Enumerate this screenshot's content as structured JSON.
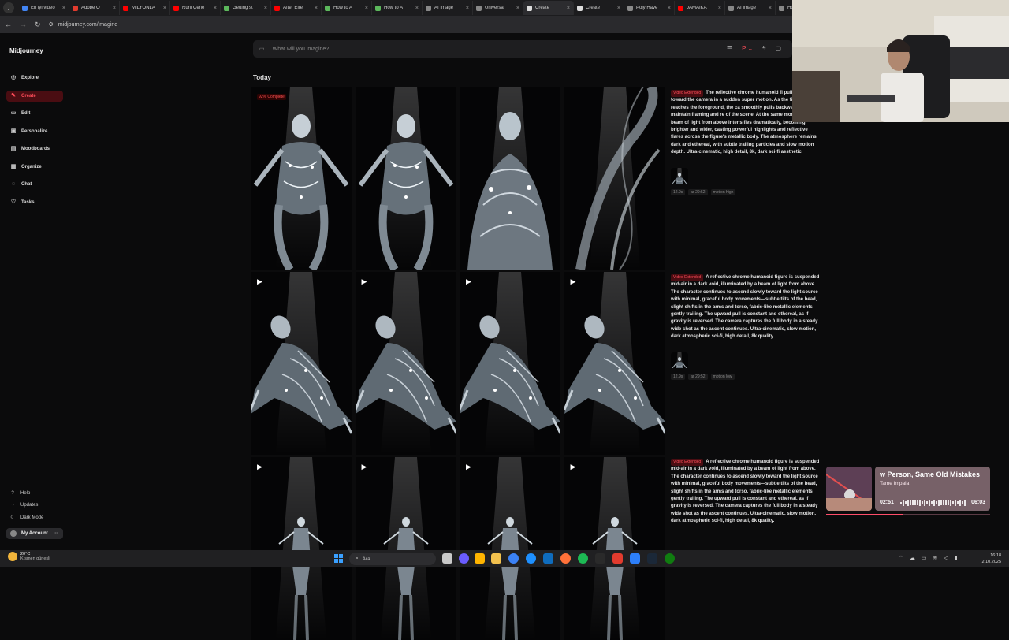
{
  "browser": {
    "tabs": [
      {
        "title": "En iyi video",
        "color": "#4285f4"
      },
      {
        "title": "Adobe Ö",
        "color": "#e23b2e"
      },
      {
        "title": "MİLYONLA",
        "color": "#ff0000"
      },
      {
        "title": "Ruhi Çene",
        "color": "#ff0000"
      },
      {
        "title": "Getting st",
        "color": "#5cb85c"
      },
      {
        "title": "After Effe",
        "color": "#ff0000"
      },
      {
        "title": "How to A",
        "color": "#5cb85c"
      },
      {
        "title": "How to A",
        "color": "#5cb85c"
      },
      {
        "title": "AI Image",
        "color": "#888888"
      },
      {
        "title": "Universal",
        "color": "#888888"
      },
      {
        "title": "Create",
        "color": "#dddddd",
        "active": true
      },
      {
        "title": "Create",
        "color": "#dddddd"
      },
      {
        "title": "Poly Have",
        "color": "#8a8a8a"
      },
      {
        "title": "JAMAİKA",
        "color": "#ff0000"
      },
      {
        "title": "AI Image",
        "color": "#888888"
      },
      {
        "title": "Ho",
        "color": "#888888"
      }
    ],
    "close_glyph": "×",
    "url": "midjourney.com/imagine"
  },
  "sidebar": {
    "brand": "Midjourney",
    "items": [
      {
        "label": "Explore",
        "icon": "compass-icon",
        "glyph": "◎"
      },
      {
        "label": "Create",
        "icon": "paintbrush-icon",
        "glyph": "✎",
        "active": true
      },
      {
        "label": "Edit",
        "icon": "edit-icon",
        "glyph": "▭"
      },
      {
        "label": "Personalize",
        "icon": "personalize-icon",
        "glyph": "▣"
      },
      {
        "label": "Moodboards",
        "icon": "moodboards-icon",
        "glyph": "▤"
      },
      {
        "label": "Organize",
        "icon": "organize-icon",
        "glyph": "▦"
      },
      {
        "label": "Chat",
        "icon": "chat-icon",
        "glyph": "◌"
      },
      {
        "label": "Tasks",
        "icon": "thumbs-up-icon",
        "glyph": "♡"
      }
    ],
    "bottom": [
      {
        "label": "Help",
        "glyph": "?"
      },
      {
        "label": "Updates",
        "glyph": "◔"
      },
      {
        "label": "Dark Mode",
        "glyph": "☾"
      }
    ],
    "account": "My Account"
  },
  "prompt_bar": {
    "placeholder": "What will you imagine?"
  },
  "feed": {
    "section": "Today",
    "groups": [
      {
        "badge": "Video Extended",
        "progress": "92% Complete",
        "text": "The reflective chrome humanoid fi pulled rapidly toward the camera in a sudden super motion. As the figure reaches the foreground, the ca smoothly pulls backward to maintain framing and re of the scene. At the same moment, the beam of light from above intensifies dramatically, becoming brighter and wider, casting powerful highlights and reflective flares across the figure's metallic body. The atmosphere remains dark and ethereal, with subtle trailing particles and slow motion depth. Ultra-cinematic, high detail, 8k, dark sci-fi aesthetic.",
        "meta": [
          "12.9s",
          "ar 29:52",
          "motion high"
        ]
      },
      {
        "badge": "Video Extended",
        "text": "A reflective chrome humanoid figure is suspended mid-air in a dark void, illuminated by a beam of light from above. The character continues to ascend slowly toward the light source with minimal, graceful body movements—subtle tilts of the head, slight shifts in the arms and torso, fabric-like metallic elements gently trailing. The upward pull is constant and ethereal, as if gravity is reversed. The camera captures the full body in a steady wide shot as the ascent continues. Ultra-cinematic, slow motion, dark atmospheric sci-fi, high detail, 8k quality.",
        "meta": [
          "12.9s",
          "ar 29:52",
          "motion low"
        ]
      },
      {
        "badge": "Video Extended",
        "text": "A reflective chrome humanoid figure is suspended mid-air in a dark void, illuminated by a beam of light from above. The character continues to ascend slowly toward the light source with minimal, graceful body movements—subtle tilts of the head, slight shifts in the arms and torso, fabric-like metallic elements gently trailing. The upward pull is constant and ethereal, as if gravity is reversed. The camera captures the full body in a steady wide shot as the ascent continues. Ultra-cinematic, slow motion, dark atmospheric sci-fi, high detail, 8k quality."
      }
    ],
    "play_glyph": "▶"
  },
  "music": {
    "track": "w Person, Same Old Mistakes",
    "artist": "Tame Impala",
    "current": "02:51",
    "total": "06:03",
    "progress": 0.47
  },
  "taskbar": {
    "temp": "20°C",
    "weather": "Kısmen güneşli",
    "search": "Ara",
    "time": "16:18",
    "date": "2.10.2025"
  }
}
